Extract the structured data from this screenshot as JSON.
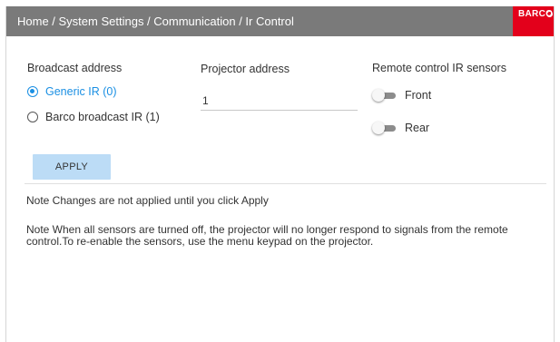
{
  "header": {
    "breadcrumb": "Home / System Settings / Communication / Ir Control",
    "logo_text": "BARCO",
    "background_color": "#7a7a7a",
    "logo_color": "#e3001b"
  },
  "broadcast": {
    "label": "Broadcast address",
    "options": [
      {
        "label": "Generic IR (0)",
        "checked": true
      },
      {
        "label": "Barco broadcast IR (1)",
        "checked": false
      }
    ]
  },
  "projector": {
    "label": "Projector address",
    "value": "1"
  },
  "sensors": {
    "label": "Remote control IR sensors",
    "items": [
      {
        "label": "Front",
        "on": false
      },
      {
        "label": "Rear",
        "on": false
      }
    ]
  },
  "apply": {
    "label": "APPLY",
    "color": "#bcdcf6"
  },
  "notes": {
    "apply_note": "Note Changes are not applied until you click Apply",
    "sensor_note": "Note When all sensors are turned off, the projector will no longer respond to signals from the remote control.To re-enable the sensors, use the menu keypad on the projector."
  },
  "accent_color": "#1a8fe3",
  "icons": {
    "radio_checked": "radio-checked-icon",
    "radio_unchecked": "radio-unchecked-icon",
    "toggle": "toggle-switch-icon"
  }
}
